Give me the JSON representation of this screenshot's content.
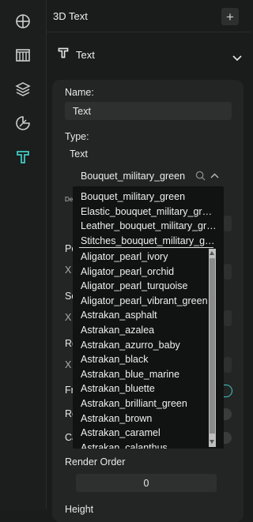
{
  "rail": {
    "items": [
      {
        "icon": "crosshair-icon"
      },
      {
        "icon": "library-icon"
      },
      {
        "icon": "layers-icon"
      },
      {
        "icon": "palette-icon"
      },
      {
        "icon": "text-tool-icon",
        "active": true
      }
    ]
  },
  "header": {
    "title": "3D Text",
    "add_label": "+"
  },
  "section": {
    "title": "Text"
  },
  "form": {
    "name_label": "Name:",
    "name_value": "Text",
    "type_label": "Type:",
    "type_value": "Text",
    "selected_material": "Bouquet_military_green",
    "render_order_label": "Render Order",
    "render_order_value": "0",
    "height_label": "Height",
    "hidden_partial": {
      "de": "De",
      "po": "Po",
      "x": "X",
      "sc": "Sc",
      "ro": "Ro",
      "fr": "Fr",
      "re": "Re",
      "ca": "Ca"
    }
  },
  "dropdown": {
    "favorites": [
      "Bouquet_military_green",
      "Elastic_bouquet_military_green",
      "Leather_bouquet_military_gre...",
      "Stitches_bouquet_military_gre..."
    ],
    "options": [
      "Aligator_pearl_ivory",
      "Aligator_pearl_orchid",
      "Aligator_pearl_turquoise",
      "Aligator_pearl_vibrant_green",
      "Astrakan_asphalt",
      "Astrakan_azalea",
      "Astrakan_azurro_baby",
      "Astrakan_black",
      "Astrakan_blue_marine",
      "Astrakan_bluette",
      "Astrakan_brilliant_green",
      "Astrakan_brown",
      "Astrakan_caramel",
      "Astrakan_calanthus"
    ]
  },
  "colors": {
    "accent": "#3fc9c0",
    "panel": "#232525",
    "bg": "#1a1b1b"
  }
}
